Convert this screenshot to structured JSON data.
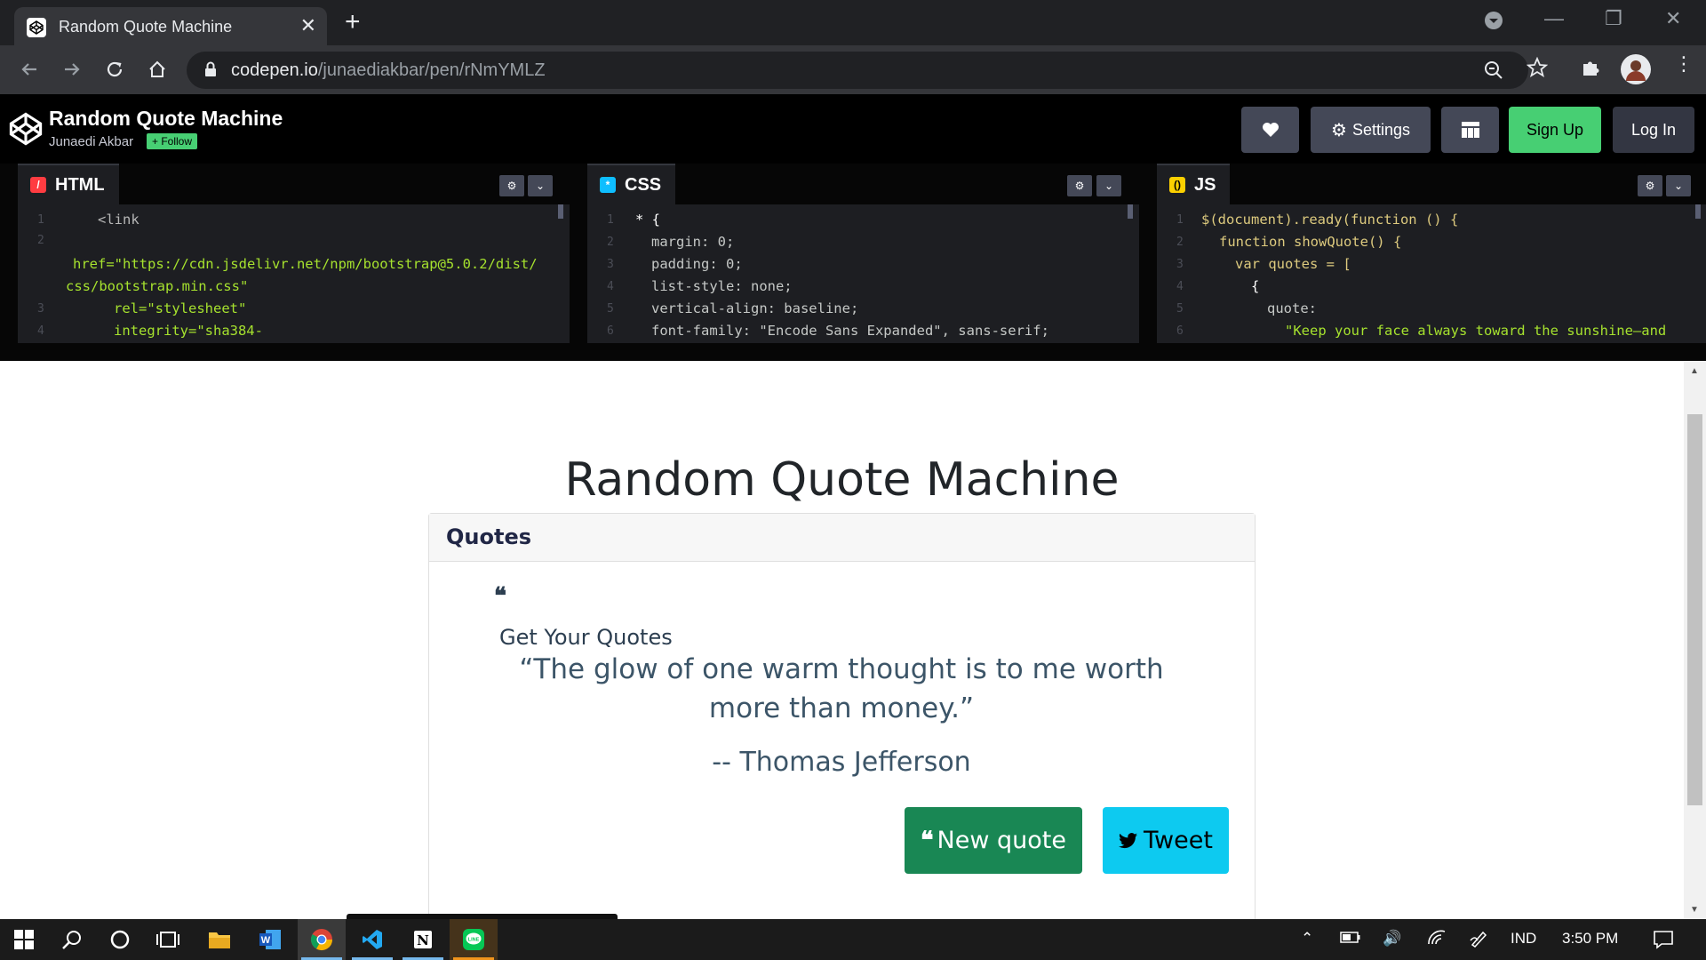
{
  "browser": {
    "tab_title": "Random Quote Machine",
    "url_host": "codepen.io",
    "url_path": "/junaediakbar/pen/rNmYMLZ"
  },
  "codepen": {
    "pen_title": "Random Quote Machine",
    "author": "Junaedi Akbar",
    "follow_label": "+ Follow",
    "settings_label": "Settings",
    "signup_label": "Sign Up",
    "login_label": "Log In"
  },
  "editors": {
    "html": {
      "label": "HTML",
      "lines": [
        {
          "n": "1",
          "text": "<link"
        },
        {
          "n": "2",
          "text": "href=\"https://cdn.jsdelivr.net/npm/bootstrap@5.0.2/dist/"
        },
        {
          "n": "",
          "text": "css/bootstrap.min.css\""
        },
        {
          "n": "3",
          "text": "rel=\"stylesheet\""
        },
        {
          "n": "4",
          "text": "integrity=\"sha384-"
        }
      ]
    },
    "css": {
      "label": "CSS",
      "lines": [
        {
          "n": "1",
          "text": "* {"
        },
        {
          "n": "2",
          "text": "margin: 0;"
        },
        {
          "n": "3",
          "text": "padding: 0;"
        },
        {
          "n": "4",
          "text": "list-style: none;"
        },
        {
          "n": "5",
          "text": "vertical-align: baseline;"
        },
        {
          "n": "6",
          "text": "font-family: \"Encode Sans Expanded\", sans-serif;"
        }
      ]
    },
    "js": {
      "label": "JS",
      "lines": [
        {
          "n": "1",
          "text": "$(document).ready(function () {"
        },
        {
          "n": "2",
          "text": "function showQuote() {"
        },
        {
          "n": "3",
          "text": "var quotes = ["
        },
        {
          "n": "4",
          "text": "{"
        },
        {
          "n": "5",
          "text": "quote:"
        },
        {
          "n": "6",
          "text": "\"Keep your face always toward the sunshine—and"
        }
      ]
    }
  },
  "preview": {
    "heading": "Random Quote Machine",
    "card_header": "Quotes",
    "subheading": "Get Your Quotes",
    "quote": "“The glow of one warm thought is to me worth more than money.”",
    "author": "-- Thomas Jefferson",
    "new_quote_label": "New quote",
    "tweet_label": "Tweet"
  },
  "taskbar": {
    "language": "IND",
    "time": "3:50 PM"
  },
  "colors": {
    "codepen_green": "#47cf73",
    "button_green": "#198754",
    "button_cyan": "#0dcaf0"
  }
}
